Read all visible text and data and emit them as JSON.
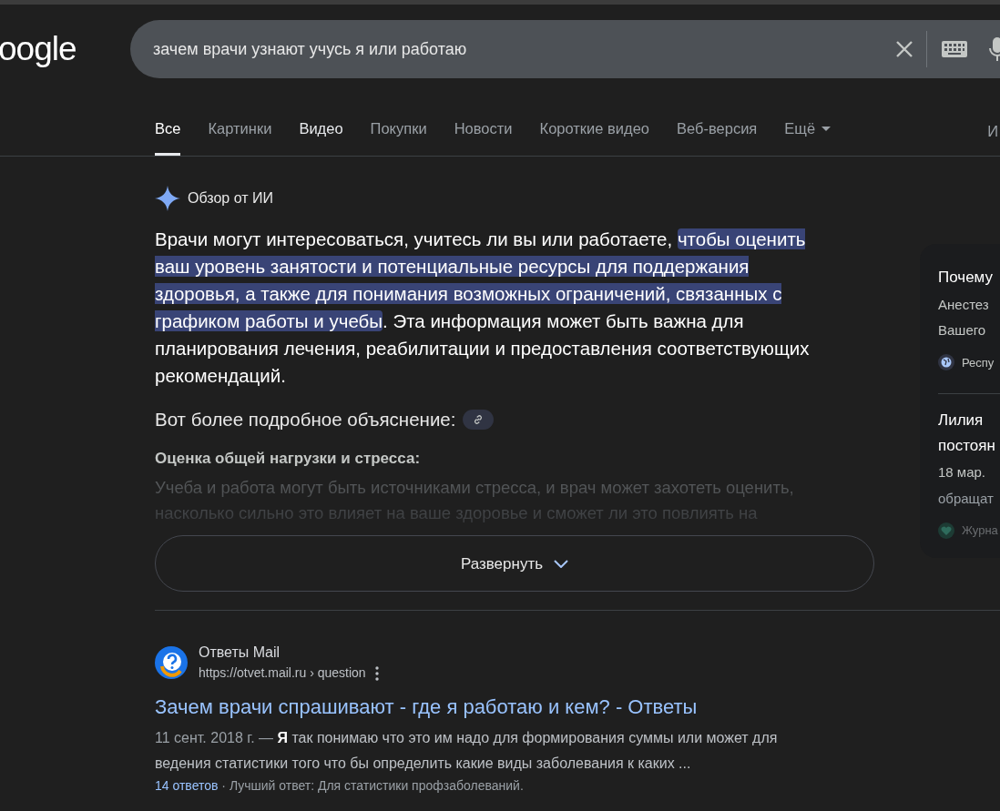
{
  "header": {
    "logo": "oogle",
    "search": {
      "value": "зачем врачи узнают учусь я или работаю"
    }
  },
  "tabs": [
    {
      "label": "Все",
      "selected": true,
      "bright": true,
      "has_menu": false
    },
    {
      "label": "Картинки",
      "selected": false,
      "bright": false,
      "has_menu": false
    },
    {
      "label": "Видео",
      "selected": false,
      "bright": true,
      "has_menu": false
    },
    {
      "label": "Покупки",
      "selected": false,
      "bright": false,
      "has_menu": false
    },
    {
      "label": "Новости",
      "selected": false,
      "bright": false,
      "has_menu": false
    },
    {
      "label": "Короткие видео",
      "selected": false,
      "bright": false,
      "has_menu": false
    },
    {
      "label": "Веб-версия",
      "selected": false,
      "bright": false,
      "has_menu": false
    },
    {
      "label": "Ещё",
      "selected": false,
      "bright": false,
      "has_menu": true
    }
  ],
  "tools_tab": "И",
  "ai_overview": {
    "title": "Обзор от ИИ",
    "paragraph": [
      {
        "text": "Врачи могут интересоваться, учитесь ли вы или работаете, ",
        "highlighted": false
      },
      {
        "text": "чтобы оценить ваш уровень занятости и потенциальные ресурсы для поддержания здоровья, а также для понимания возможных ограничений, связанных с графиком работы и учебы",
        "highlighted": true
      },
      {
        "text": ". Эта информация может быть важна для планирования лечения, реабилитации и предоставления соответствующих рекомендаций.",
        "highlighted": false
      }
    ],
    "intro": "Вот более подробное объяснение:",
    "subheading": "Оценка общей нагрузки и стресса:",
    "faded_text": "Учеба и работа могут быть источниками стресса, и врач может захотеть оценить, насколько сильно это влияет на ваше здоровье и сможет ли это повлиять на",
    "expand_button": "Развернуть",
    "sources": [
      {
        "title": "Почему",
        "lines": [
          "Анестез",
          "Вашего"
        ],
        "site": "Респу",
        "kind": "globe"
      },
      {
        "title": "Лилия",
        "lines": [
          "постоян"
        ],
        "date": "18 мар.",
        "snippet": "обращат",
        "site": "Журна",
        "kind": "logo"
      }
    ]
  },
  "results": [
    {
      "site": "Ответы Mail",
      "url": "https://otvet.mail.ru › question",
      "title": "Зачем врачи спрашивают - где я работаю и кем? - Ответы",
      "date": "11 сент. 2018 г. —",
      "snippet": "**Я** так понимаю что это им надо для формирования суммы или может для ведения статистики того что бы определить какие виды заболевания к каких ...",
      "answers": "14 ответов",
      "best": "· Лучший ответ: Для статистики профзаболеваний."
    }
  ]
}
